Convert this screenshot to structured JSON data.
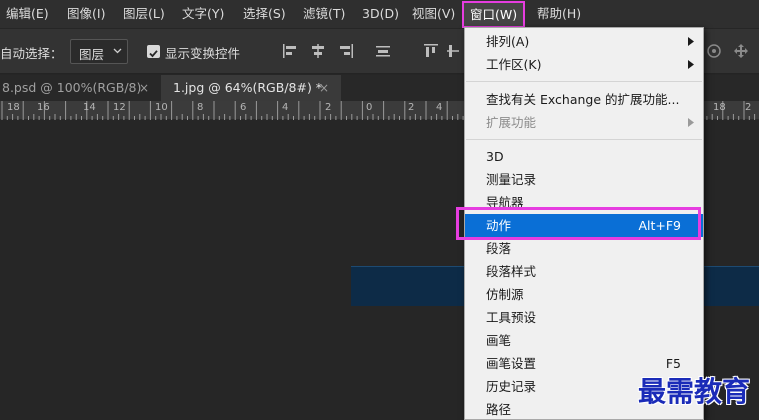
{
  "menubar": {
    "items": [
      {
        "label": "编辑(E)"
      },
      {
        "label": "图像(I)"
      },
      {
        "label": "图层(L)"
      },
      {
        "label": "文字(Y)"
      },
      {
        "label": "选择(S)"
      },
      {
        "label": "滤镜(T)"
      },
      {
        "label": "3D(D)"
      },
      {
        "label": "视图(V)"
      },
      {
        "label": "窗口(W)",
        "active": true
      },
      {
        "label": "帮助(H)"
      }
    ]
  },
  "options": {
    "auto_select_label": "自动选择：",
    "auto_select_value": "图层",
    "show_transform_label": "显示变换控件",
    "show_transform_checked": true
  },
  "tabs": [
    {
      "label": "8.psd @ 100%(RGB/8)",
      "close": "×"
    },
    {
      "label": "1.jpg @ 64%(RGB/8#) *",
      "close": "×",
      "active": true
    }
  ],
  "ruler": {
    "ticks": [
      "18",
      "16",
      "14",
      "12",
      "10",
      "8",
      "6",
      "4",
      "2",
      "0",
      "2",
      "4",
      "18",
      "2"
    ]
  },
  "window_menu": {
    "items": [
      {
        "label": "排列(A)",
        "submenu": true
      },
      {
        "label": "工作区(K)",
        "submenu": true
      },
      {
        "separator": true
      },
      {
        "label": "查找有关 Exchange 的扩展功能..."
      },
      {
        "label": "扩展功能",
        "submenu": true,
        "disabled": true
      },
      {
        "separator": true
      },
      {
        "label": "3D"
      },
      {
        "label": "测量记录"
      },
      {
        "label": "导航器"
      },
      {
        "label": "动作",
        "shortcut": "Alt+F9",
        "highlighted": true
      },
      {
        "label": "段落"
      },
      {
        "label": "段落样式"
      },
      {
        "label": "仿制源"
      },
      {
        "label": "工具预设"
      },
      {
        "label": "画笔"
      },
      {
        "label": "画笔设置",
        "shortcut": "F5"
      },
      {
        "label": "历史记录"
      },
      {
        "label": "路径"
      }
    ]
  },
  "colors": {
    "highlight_frame": "#e63de0",
    "menu_highlight": "#0a6fd6"
  },
  "watermark": {
    "text": "最需教育"
  }
}
